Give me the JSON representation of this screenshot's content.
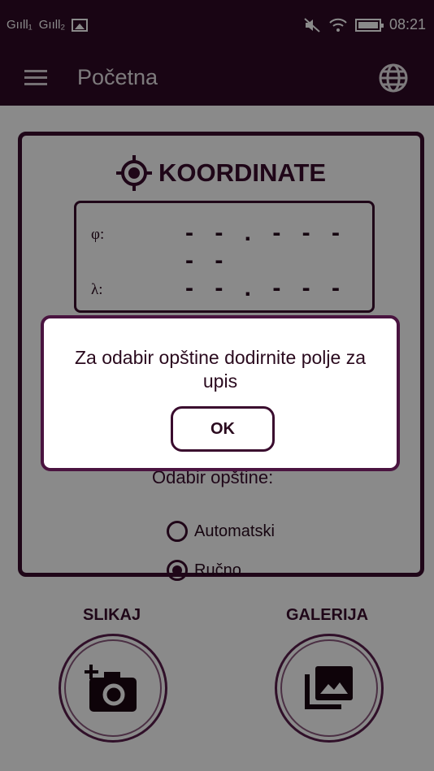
{
  "status_bar": {
    "carrier1": "Gııll₁",
    "carrier2": "Gııll₂",
    "time": "08:21",
    "icons": [
      "signal-icon",
      "image-icon",
      "mute-icon",
      "wifi-icon",
      "battery-icon"
    ]
  },
  "app_bar": {
    "title": "Početna",
    "menu_icon": "menu-icon",
    "globe_icon": "globe-icon"
  },
  "coordinates": {
    "title": "KOORDINATE",
    "phi_symbol": "φ:",
    "phi_value": "- - . - - - -   -",
    "lambda_symbol": "λ:",
    "lambda_value": "- - . - - - -   -"
  },
  "municipality": {
    "label": "Odabir opštine:",
    "options": [
      {
        "label": "Automatski",
        "checked": false
      },
      {
        "label": "Ručno",
        "checked": true
      }
    ]
  },
  "actions": {
    "photo_label": "SLIKAJ",
    "gallery_label": "GALERIJA"
  },
  "dialog": {
    "message": "Za odabir opštine dodirnite polje za upis",
    "ok_label": "OK"
  },
  "colors": {
    "primary": "#2f0a25",
    "accent": "#3a0c2e"
  }
}
